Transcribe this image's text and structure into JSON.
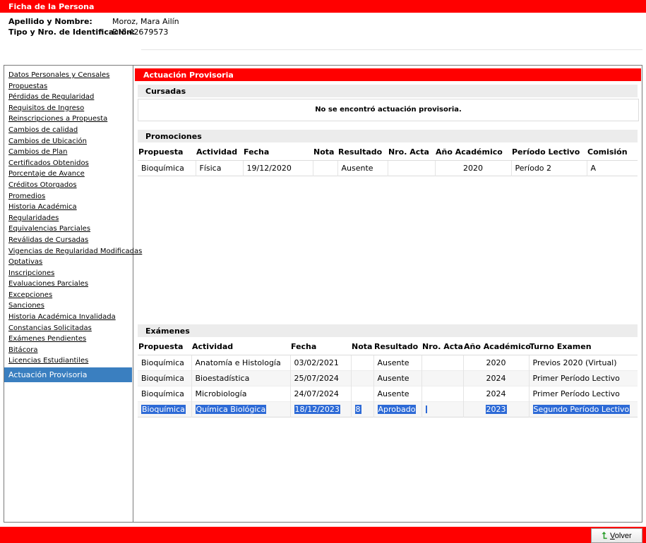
{
  "header": {
    "title": "Ficha de la Persona",
    "name_label": "Apellido y Nombre:",
    "name_value": "Moroz, Mara Ailín",
    "id_label": "Tipo y Nro. de Identificación:",
    "id_value": "DNI 42679573"
  },
  "sidebar": {
    "items": [
      "Datos Personales y Censales",
      "Propuestas",
      "Pérdidas de Regularidad",
      "Requisitos de Ingreso",
      "Reinscripciones a Propuesta",
      "Cambios de calidad",
      "Cambios de Ubicación",
      "Cambios de Plan",
      "Certificados Obtenidos",
      "Porcentaje de Avance",
      "Créditos Otorgados",
      "Promedios",
      "Historia Académica",
      "Regularidades",
      "Equivalencias Parciales",
      "Reválidas de Cursadas",
      "Vigencias de Regularidad Modificadas",
      "Optativas",
      "Inscripciones",
      "Evaluaciones Parciales",
      "Excepciones",
      "Sanciones",
      "Historia Académica Invalidada",
      "Constancias Solicitadas",
      "Exámenes Pendientes",
      "Bitácora",
      "Licencias Estudiantiles"
    ],
    "active": "Actuación Provisoria"
  },
  "main": {
    "title": "Actuación Provisoria",
    "cursadas": {
      "title": "Cursadas",
      "empty_message": "No se encontró actuación provisoria."
    },
    "promociones": {
      "title": "Promociones",
      "columns": [
        "Propuesta",
        "Actividad",
        "Fecha",
        "Nota",
        "Resultado",
        "Nro. Acta",
        "Año Académico",
        "Período Lectivo",
        "Comisión"
      ],
      "rows": [
        [
          "Bioquímica",
          "Física",
          "19/12/2020",
          "",
          "Ausente",
          "",
          "2020",
          "Período 2",
          "A"
        ]
      ]
    },
    "examenes": {
      "title": "Exámenes",
      "columns": [
        "Propuesta",
        "Actividad",
        "Fecha",
        "Nota",
        "Resultado",
        "Nro. Acta",
        "Año Académico",
        "Turno Examen"
      ],
      "rows": [
        [
          "Bioquímica",
          "Anatomía e Histología",
          "03/02/2021",
          "",
          "Ausente",
          "",
          "2020",
          "Previos 2020 (Virtual)"
        ],
        [
          "Bioquímica",
          "Bioestadística",
          "25/07/2024",
          "",
          "Ausente",
          "",
          "2024",
          "Primer Período Lectivo"
        ],
        [
          "Bioquímica",
          "Microbiología",
          "24/07/2024",
          "",
          "Ausente",
          "",
          "2024",
          "Primer Período Lectivo"
        ],
        [
          "Bioquímica",
          "Química Biológica",
          "18/12/2023",
          "8",
          "Aprobado",
          "",
          "2023",
          "Segundo Período Lectivo"
        ]
      ],
      "selected_row": 3
    }
  },
  "footer": {
    "back_label": "Volver",
    "back_icon": "green-return-arrow-icon"
  },
  "colors": {
    "brand_red": "#ff0000",
    "active_blue": "#3a7fc0",
    "selection_blue": "#2d6ad6",
    "section_gray": "#ececec"
  }
}
